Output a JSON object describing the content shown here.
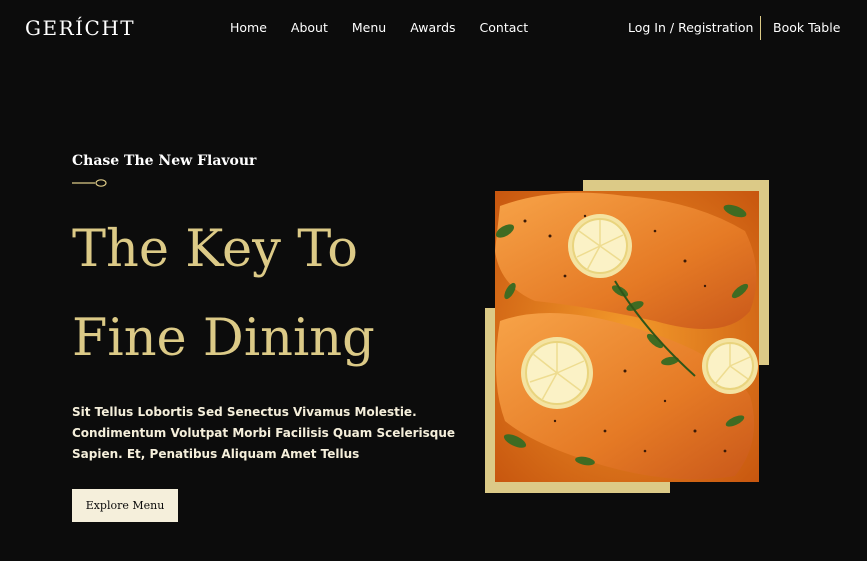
{
  "navbar": {
    "logo": "GERÍCHT",
    "links": [
      {
        "label": "Home"
      },
      {
        "label": "About"
      },
      {
        "label": "Menu"
      },
      {
        "label": "Awards"
      },
      {
        "label": "Contact"
      }
    ],
    "auth_label": "Log In / Registration",
    "book_label": "Book Table"
  },
  "hero": {
    "subtitle": "Chase The New Flavour",
    "title_lines": [
      "The Key To",
      "Fine Dining"
    ],
    "description_lines": [
      "Sit Tellus Lobortis Sed Senectus Vivamus Molestie.",
      "Condimentum Volutpat Morbi Facilisis Quam Scelerisque",
      "Sapien. Et, Penatibus Aliquam Amet Tellus"
    ],
    "button_label": "Explore Menu",
    "image_icon": "salmon-dish-image",
    "divider_icon": "spoon-icon"
  },
  "colors": {
    "background": "#0C0C0C",
    "golden": "#DCCA87",
    "crimson": "#F5EFDB",
    "white": "#FFFFFF"
  }
}
